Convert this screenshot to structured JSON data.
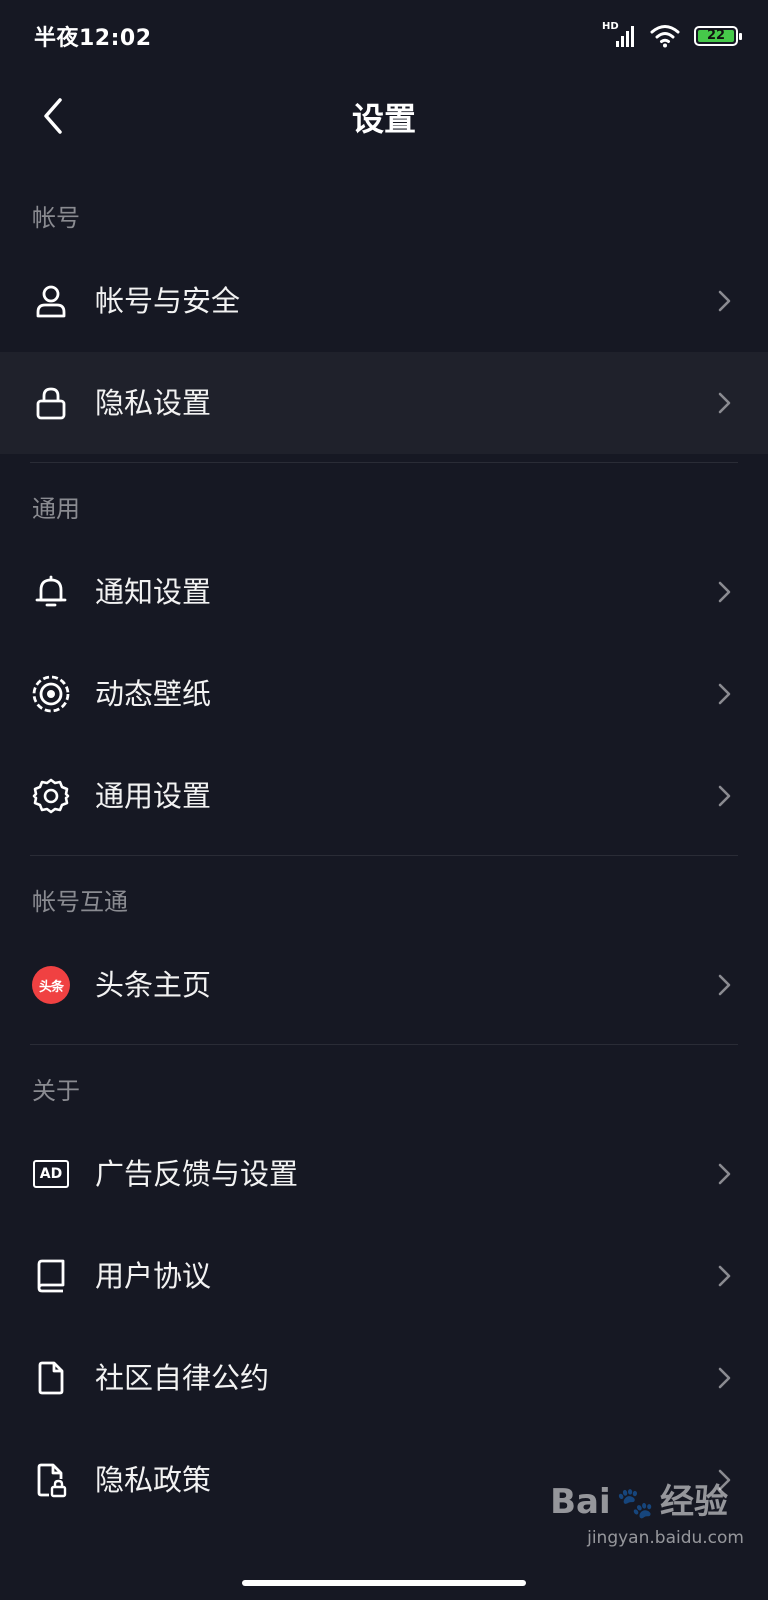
{
  "status_bar": {
    "time": "半夜12:02",
    "network_label": "HD",
    "battery_level": "22"
  },
  "header": {
    "title": "设置"
  },
  "sections": [
    {
      "title": "帐号",
      "items": [
        {
          "label": "帐号与安全",
          "icon": "user-icon"
        },
        {
          "label": "隐私设置",
          "icon": "lock-icon",
          "highlighted": true
        }
      ]
    },
    {
      "title": "通用",
      "items": [
        {
          "label": "通知设置",
          "icon": "bell-icon"
        },
        {
          "label": "动态壁纸",
          "icon": "target-icon"
        },
        {
          "label": "通用设置",
          "icon": "gear-icon"
        }
      ]
    },
    {
      "title": "帐号互通",
      "items": [
        {
          "label": "头条主页",
          "icon": "toutiao-icon",
          "badge_text": "头条"
        }
      ]
    },
    {
      "title": "关于",
      "items": [
        {
          "label": "广告反馈与设置",
          "icon": "ad-icon",
          "icon_text": "AD"
        },
        {
          "label": "用户协议",
          "icon": "book-icon"
        },
        {
          "label": "社区自律公约",
          "icon": "document-icon"
        },
        {
          "label": "隐私政策",
          "icon": "privacy-document-icon"
        }
      ]
    }
  ],
  "watermark": {
    "brand": "Bai",
    "brand_suffix": "经验",
    "site": "jingyan.baidu.com"
  },
  "colors": {
    "background": "#161823",
    "highlight_row": "#1f212b",
    "section_title": "#8a8b91",
    "toutiao_red": "#f04142",
    "battery_green": "#46c94a"
  }
}
